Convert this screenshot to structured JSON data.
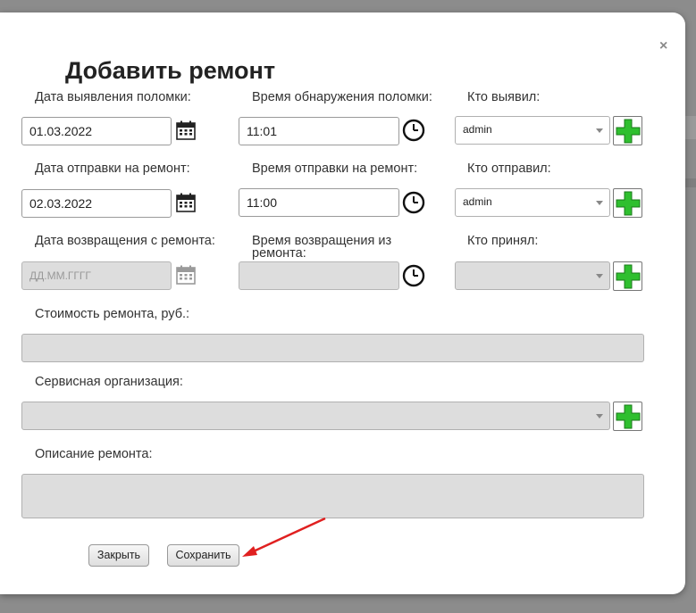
{
  "dialog": {
    "title": "Добавить ремонт",
    "close_label": "×"
  },
  "labels": {
    "detect_date": "Дата выявления поломки:",
    "detect_time": "Время обнаружения поломки:",
    "detected_by": "Кто выявил:",
    "send_date": "Дата отправки на ремонт:",
    "send_time": "Время отправки на ремонт:",
    "sent_by": "Кто отправил:",
    "return_date": "Дата возвращения с ремонта:",
    "return_time": "Время возвращения из ремонта:",
    "received_by": "Кто принял:",
    "cost": "Стоимость ремонта, руб.:",
    "service_org": "Сервисная организация:",
    "description": "Описание ремонта:"
  },
  "fields": {
    "detect_date": "01.03.2022",
    "detect_time": "11:01",
    "detected_by": "admin",
    "send_date": "02.03.2022",
    "send_time": "11:00",
    "sent_by": "admin",
    "return_date_placeholder": "ДД.ММ.ГГГГ",
    "return_time": "",
    "received_by": "",
    "cost": "",
    "service_org": "",
    "description": ""
  },
  "buttons": {
    "close": "Закрыть",
    "save": "Сохранить"
  },
  "colors": {
    "plus_green": "#2fbf2f",
    "annotation_arrow": "#e02020"
  }
}
